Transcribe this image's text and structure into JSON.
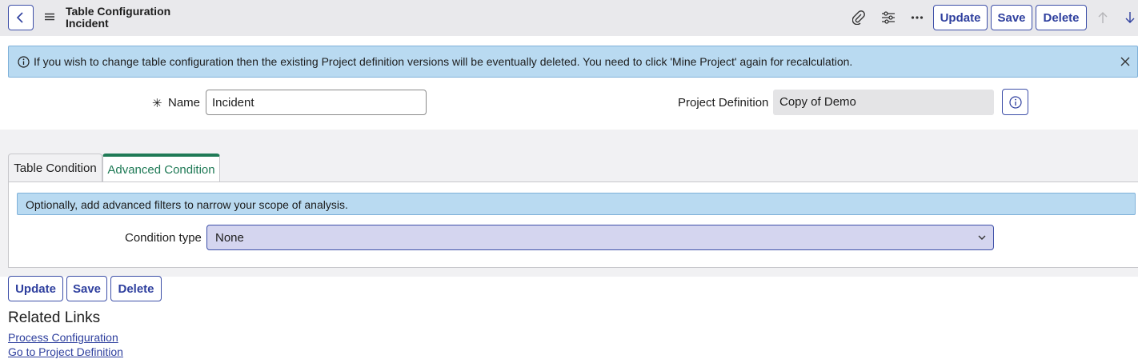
{
  "header": {
    "title_line1": "Table Configuration",
    "title_line2": "Incident",
    "icons": [
      "back-icon",
      "hamburger-icon",
      "paperclip-icon",
      "sliders-icon",
      "more-icon",
      "arrow-up-icon",
      "arrow-down-icon"
    ],
    "update_label": "Update",
    "save_label": "Save",
    "delete_label": "Delete"
  },
  "info_banner": {
    "message": "If you wish to change table configuration then the existing Project definition versions will be eventually deleted. You need to click 'Mine Project' again for recalculation."
  },
  "form": {
    "required_mark": "✳",
    "name_label": "Name",
    "name_value": "Incident",
    "project_definition_label": "Project Definition",
    "project_definition_value": "Copy of Demo"
  },
  "tabs": [
    {
      "label": "Table Condition",
      "active": false
    },
    {
      "label": "Advanced Condition",
      "active": true
    }
  ],
  "advanced": {
    "hint": "Optionally, add advanced filters to narrow your scope of analysis.",
    "condition_type_label": "Condition type",
    "condition_type_value": "None"
  },
  "footer": {
    "update_label": "Update",
    "save_label": "Save",
    "delete_label": "Delete"
  },
  "related_links": {
    "title": "Related Links",
    "items": [
      "Process Configuration",
      "Go to Project Definition"
    ]
  },
  "colors": {
    "accent": "#2e3f9e",
    "tab_active": "#1f7a56",
    "banner_bg": "#b9daf1",
    "select_bg": "#d4d5ef"
  }
}
